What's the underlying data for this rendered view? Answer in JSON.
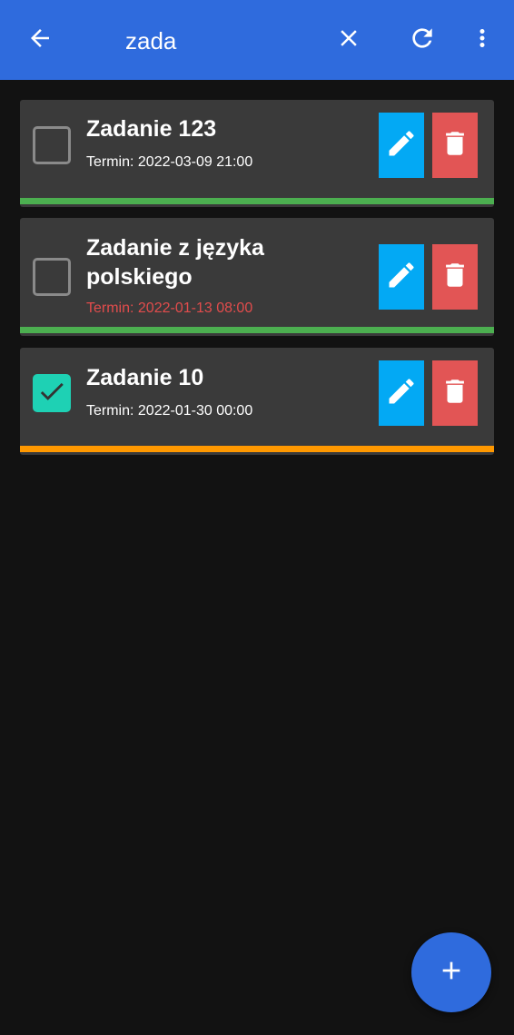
{
  "colors": {
    "primary": "#2F6BDD",
    "background": "#121212",
    "card": "#3a3a3a",
    "edit": "#03A9F4",
    "delete": "#E25555",
    "checked": "#1ED1B4",
    "overdue": "#E24C4C",
    "status_green": "#4CAF50",
    "status_orange": "#FF9800"
  },
  "appbar": {
    "back_icon": "arrow-left-icon",
    "search_query": "zada",
    "clear_icon": "close-icon",
    "refresh_icon": "refresh-icon",
    "more_icon": "more-vertical-icon"
  },
  "tasks": [
    {
      "title": "Zadanie 123",
      "deadline": "Termin: 2022-03-09 21:00",
      "done": false,
      "overdue": false,
      "status_color": "#4CAF50"
    },
    {
      "title": "Zadanie z języka polskiego",
      "deadline": "Termin: 2022-01-13 08:00",
      "done": false,
      "overdue": true,
      "status_color": "#4CAF50"
    },
    {
      "title": "Zadanie 10",
      "deadline": "Termin: 2022-01-30 00:00",
      "done": true,
      "overdue": false,
      "status_color": "#FF9800"
    }
  ],
  "actions": {
    "edit_icon": "pencil-icon",
    "delete_icon": "trash-icon"
  },
  "fab": {
    "icon": "plus-icon"
  }
}
